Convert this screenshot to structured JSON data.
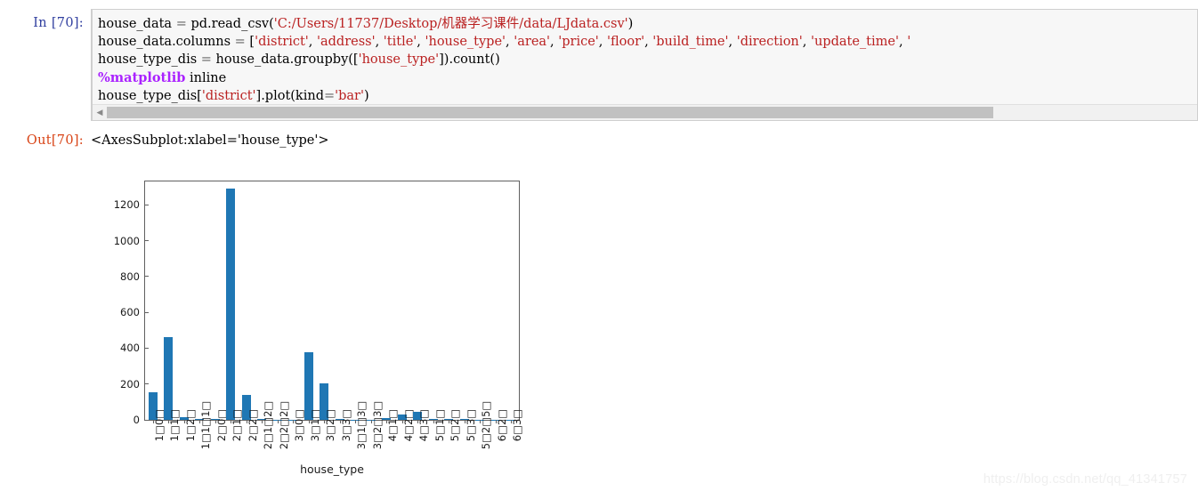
{
  "notebook": {
    "input_prompt": "In  [70]:",
    "output_prompt": "Out[70]:",
    "output_text": "<AxesSubplot:xlabel='house_type'>",
    "code_lines": [
      [
        {
          "t": "plain",
          "s": "house_data "
        },
        {
          "t": "op",
          "s": "="
        },
        {
          "t": "plain",
          "s": " pd."
        },
        {
          "t": "plain",
          "s": "read_csv("
        },
        {
          "t": "str",
          "s": "'C:/Users/11737/Desktop/机器学习课件/data/LJdata.csv'"
        },
        {
          "t": "plain",
          "s": ")"
        }
      ],
      [
        {
          "t": "plain",
          "s": "house_data.columns "
        },
        {
          "t": "op",
          "s": "="
        },
        {
          "t": "plain",
          "s": " ["
        },
        {
          "t": "str",
          "s": "'district'"
        },
        {
          "t": "plain",
          "s": ", "
        },
        {
          "t": "str",
          "s": "'address'"
        },
        {
          "t": "plain",
          "s": ", "
        },
        {
          "t": "str",
          "s": "'title'"
        },
        {
          "t": "plain",
          "s": ", "
        },
        {
          "t": "str",
          "s": "'house_type'"
        },
        {
          "t": "plain",
          "s": ", "
        },
        {
          "t": "str",
          "s": "'area'"
        },
        {
          "t": "plain",
          "s": ", "
        },
        {
          "t": "str",
          "s": "'price'"
        },
        {
          "t": "plain",
          "s": ", "
        },
        {
          "t": "str",
          "s": "'floor'"
        },
        {
          "t": "plain",
          "s": ", "
        },
        {
          "t": "str",
          "s": "'build_time'"
        },
        {
          "t": "plain",
          "s": ", "
        },
        {
          "t": "str",
          "s": "'direction'"
        },
        {
          "t": "plain",
          "s": ", "
        },
        {
          "t": "str",
          "s": "'update_time'"
        },
        {
          "t": "plain",
          "s": ", "
        },
        {
          "t": "str",
          "s": "'"
        }
      ],
      [
        {
          "t": "plain",
          "s": "house_type_dis "
        },
        {
          "t": "op",
          "s": "="
        },
        {
          "t": "plain",
          "s": " house_data.groupby(["
        },
        {
          "t": "str",
          "s": "'house_type'"
        },
        {
          "t": "plain",
          "s": "]).count()"
        }
      ],
      [
        {
          "t": "magic",
          "s": "%matplotlib"
        },
        {
          "t": "plain",
          "s": " inline"
        }
      ],
      [
        {
          "t": "plain",
          "s": "house_type_dis["
        },
        {
          "t": "str",
          "s": "'district'"
        },
        {
          "t": "plain",
          "s": "].plot(kind"
        },
        {
          "t": "op",
          "s": "="
        },
        {
          "t": "str",
          "s": "'bar'"
        },
        {
          "t": "plain",
          "s": ")"
        }
      ]
    ],
    "scrollbar": {
      "left_arrow_icon": "triangle-left-icon"
    }
  },
  "watermark": {
    "text": "https://blog.csdn.net/qq_41341757"
  },
  "chart_data": {
    "type": "bar",
    "title": "",
    "xlabel": "house_type",
    "ylabel": "",
    "ylim": [
      0,
      1330
    ],
    "yticks": [
      0,
      200,
      400,
      600,
      800,
      1000,
      1200
    ],
    "grid": false,
    "legend": false,
    "bar_color": "#1f77b4",
    "categories": [
      "1□0□",
      "1□1□",
      "1□2□",
      "1□1□1□",
      "2□0□",
      "2□1□",
      "2□2□",
      "2□1□2□",
      "2□2□2□",
      "3□0□",
      "3□1□",
      "3□2□",
      "3□3□",
      "3□1□3□",
      "3□2□3□",
      "4□1□",
      "4□2□",
      "4□3□",
      "5□1□",
      "5□2□",
      "5□3□",
      "5□2□5□",
      "6□2□",
      "6□3□"
    ],
    "values": [
      155,
      460,
      15,
      5,
      6,
      1290,
      140,
      5,
      2,
      2,
      375,
      205,
      3,
      2,
      2,
      10,
      28,
      45,
      4,
      7,
      6,
      2,
      2,
      2
    ]
  }
}
